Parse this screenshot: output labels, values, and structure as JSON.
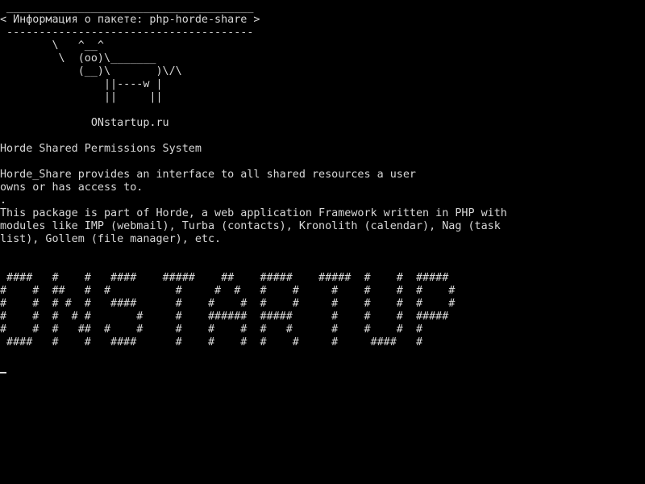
{
  "colors": {
    "background": "#000000",
    "foreground": "#d8d8d8"
  },
  "terminal": {
    "lines": [
      " ______________________________________",
      "< Информация о пакете: php-horde-share >",
      " --------------------------------------",
      "        \\   ^__^",
      "         \\  (oo)\\_______",
      "            (__)\\       )\\/\\",
      "                ||----w |",
      "                ||     ||",
      "",
      "              ONstartup.ru",
      "",
      "Horde Shared Permissions System",
      "",
      "Horde_Share provides an interface to all shared resources a user",
      "owns or has access to.",
      ".",
      "This package is part of Horde, a web application Framework written in PHP with",
      "modules like IMP (webmail), Turba (contacts), Kronolith (calendar), Nag (task",
      "list), Gollem (file manager), etc.",
      "",
      "",
      " ####   #    #   ####    #####    ##    #####    #####  #    #  #####",
      "#    #  ##   #  #          #     #  #   #    #     #    #    #  #    #",
      "#    #  # #  #   ####      #    #    #  #    #     #    #    #  #    #",
      "#    #  #  # #       #     #    ######  #####      #    #    #  #####",
      "#    #  #   ##  #    #     #    #    #  #   #      #    #    #  #",
      " ####   #    #   ####      #    #    #  #    #     #     ####   #"
    ]
  },
  "cursor": {
    "symbol": "_"
  }
}
